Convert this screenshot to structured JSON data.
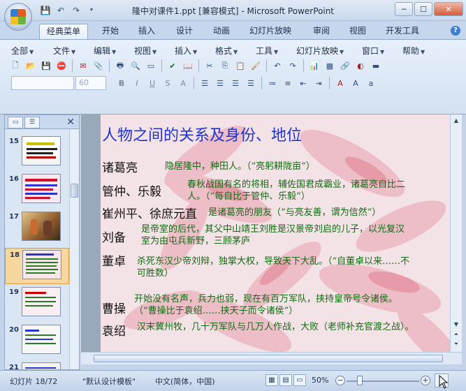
{
  "window": {
    "title": "隆中对课件1.ppt [兼容模式] - Microsoft PowerPoint",
    "controls": {
      "minimize": "─",
      "maximize": "☐",
      "close": "✕"
    }
  },
  "quick_access": {
    "save": "💾",
    "undo": "↶",
    "redo": "↷",
    "customize": "⯆"
  },
  "ribbon_tabs": [
    "经典菜单",
    "开始",
    "插入",
    "设计",
    "动画",
    "幻灯片放映",
    "审阅",
    "视图",
    "开发工具"
  ],
  "menus": [
    "全部",
    "文件",
    "编辑",
    "视图",
    "插入",
    "格式",
    "工具",
    "幻灯片放映",
    "窗口",
    "帮助"
  ],
  "font": {
    "name": "",
    "size": "60"
  },
  "slide_pane": {
    "numbers": [
      "15",
      "16",
      "17",
      "18",
      "19",
      "20",
      "21"
    ],
    "selected": "18"
  },
  "slide": {
    "title": "人物之间的关系及身份、地位",
    "people": [
      {
        "name": "诸葛亮",
        "desc": "隐居隆中，种田人。（“亮躬耕陇亩”）"
      },
      {
        "name": "管仲、乐毅",
        "desc": "春秋战国有名的将相，辅佐国君成霸业，诸葛亮自比二人。（“每自比于管仲、乐毅”）"
      },
      {
        "name": "崔州平、徐庶元直",
        "desc": "是诸葛亮的朋友（“与亮友善，谓为信然”）"
      },
      {
        "name": "刘备",
        "desc": "是帝室的后代，其父中山靖王刘胜是汉景帝刘启的儿子，以光复汉室为由屯兵新野，三顾茅庐"
      },
      {
        "name": "董卓",
        "desc": "杀死东汉少帝刘辩，独掌大权，导致天下大乱。（“自董卓以来……不可胜数）"
      },
      {
        "name": "曹操",
        "desc": "开始没有名声，兵力也弱，现在有百万军队，挟持皇帝号令诸侯。（“曹操比于袁绍……挟天子而令诸侯”）"
      },
      {
        "name": "袁绍",
        "desc": "汉末冀州牧，几十万军队与几万人作战，大败（老师补充官渡之战）。"
      }
    ]
  },
  "status": {
    "slide_info": "幻灯片 18/72",
    "template": "\"默认设计模板\"",
    "language": "中文(简体，中国)",
    "zoom": "50%",
    "zoom_fraction": 0.18
  }
}
